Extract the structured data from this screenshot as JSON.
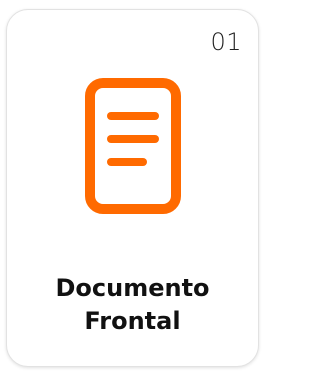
{
  "card": {
    "number": "01",
    "title_line1": "Documento",
    "title_line2": "Frontal",
    "icon": "document-icon",
    "accent_color": "#ff6a00"
  }
}
